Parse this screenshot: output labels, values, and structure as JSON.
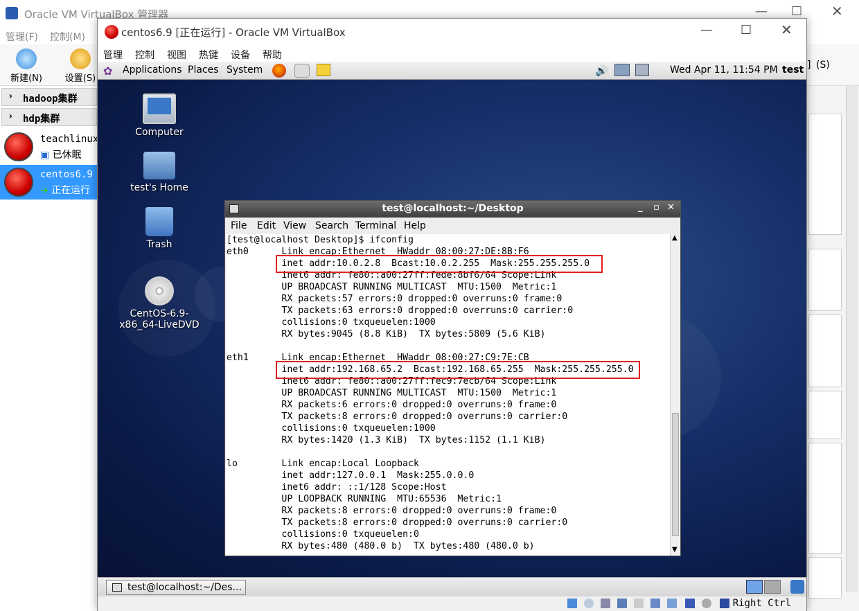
{
  "manager": {
    "title": "Oracle VM VirtualBox 管理器",
    "menu": [
      "管理(F)",
      "控制(M)"
    ],
    "toolbar": {
      "new_label": "新建(N)",
      "settings_label": "设置(S)",
      "right_label": "‍](S)"
    },
    "groups": [
      "hadoop集群",
      "hdp集群"
    ],
    "vms": [
      {
        "name": "teachlinux",
        "status": "已休眠"
      },
      {
        "name": "centos6.9",
        "status": "正在运行"
      }
    ]
  },
  "vm_window": {
    "title": "centos6.9 [正在运行] - Oracle VM VirtualBox",
    "menu": [
      "管理",
      "控制",
      "视图",
      "热键",
      "设备",
      "帮助"
    ],
    "host_key": "Right Ctrl"
  },
  "gnome": {
    "menus": [
      "Applications",
      "Places",
      "System"
    ],
    "clock": "Wed Apr 11, 11:54 PM",
    "user": "test",
    "taskbar_item": "test@localhost:~/Des..."
  },
  "desktop_icons": [
    {
      "label": "Computer"
    },
    {
      "label": "test's Home"
    },
    {
      "label": "Trash"
    },
    {
      "label": "CentOS-6.9-x86_64-LiveDVD"
    }
  ],
  "terminal": {
    "title": "test@localhost:~/Desktop",
    "menu": [
      "File",
      "Edit",
      "View",
      "Search",
      "Terminal",
      "Help"
    ],
    "output": "[test@localhost Desktop]$ ifconfig\neth0      Link encap:Ethernet  HWaddr 08:00:27:DE:8B:F6\n          inet addr:10.0.2.8  Bcast:10.0.2.255  Mask:255.255.255.0\n          inet6 addr: fe80::a00:27ff:fede:8bf6/64 Scope:Link\n          UP BROADCAST RUNNING MULTICAST  MTU:1500  Metric:1\n          RX packets:57 errors:0 dropped:0 overruns:0 frame:0\n          TX packets:63 errors:0 dropped:0 overruns:0 carrier:0\n          collisions:0 txqueuelen:1000\n          RX bytes:9045 (8.8 KiB)  TX bytes:5809 (5.6 KiB)\n\neth1      Link encap:Ethernet  HWaddr 08:00:27:C9:7E:CB\n          inet addr:192.168.65.2  Bcast:192.168.65.255  Mask:255.255.255.0\n          inet6 addr: fe80::a00:27ff:fec9:7ecb/64 Scope:Link\n          UP BROADCAST RUNNING MULTICAST  MTU:1500  Metric:1\n          RX packets:6 errors:0 dropped:0 overruns:0 frame:0\n          TX packets:8 errors:0 dropped:0 overruns:0 carrier:0\n          collisions:0 txqueuelen:1000\n          RX bytes:1420 (1.3 KiB)  TX bytes:1152 (1.1 KiB)\n\nlo        Link encap:Local Loopback\n          inet addr:127.0.0.1  Mask:255.0.0.0\n          inet6 addr: ::1/128 Scope:Host\n          UP LOOPBACK RUNNING  MTU:65536  Metric:1\n          RX packets:8 errors:0 dropped:0 overruns:0 frame:0\n          TX packets:8 errors:0 dropped:0 overruns:0 carrier:0\n          collisions:0 txqueuelen:0\n          RX bytes:480 (480.0 b)  TX bytes:480 (480.0 b)"
  },
  "colors": {
    "highlight": "#e02020",
    "selected_vm": "#3399ff",
    "desktop": "#17306a"
  }
}
